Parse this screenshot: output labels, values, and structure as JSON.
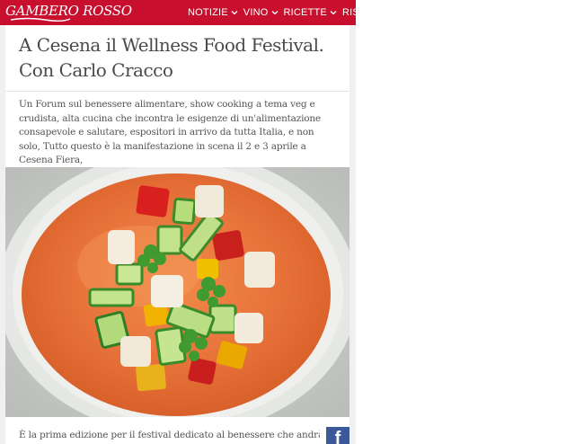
{
  "header": {
    "logo_text": "GAMBERO ROSSO",
    "brand_color": "#c8102e",
    "nav": [
      {
        "label": "NOTIZIE",
        "icon": "chevron-down-icon"
      },
      {
        "label": "VINO",
        "icon": "chevron-down-icon"
      },
      {
        "label": "RICETTE",
        "icon": "chevron-down-icon"
      },
      {
        "label": "RISTORA",
        "icon": ""
      }
    ]
  },
  "article": {
    "title": "A Cesena il Wellness Food Festival. Con Carlo Cracco",
    "lead": "Un Forum sul benessere alimentare, show cooking a tema veg e crudista, alta cucina che incontra le esigenze di un'alimentazione consapevole e salutare, espositori in arrivo da tutta Italia, e non solo, Tutto questo è la manifestazione in scena il 2 e 3 aprile a Cesena Fiera,",
    "image_icon": "gazpacho-soup-photo",
    "body_start": "È la prima edizione per il festival dedicato al benessere che andrà in scena a"
  },
  "share": {
    "facebook_glyph": "f",
    "facebook_color": "#3b5998"
  }
}
